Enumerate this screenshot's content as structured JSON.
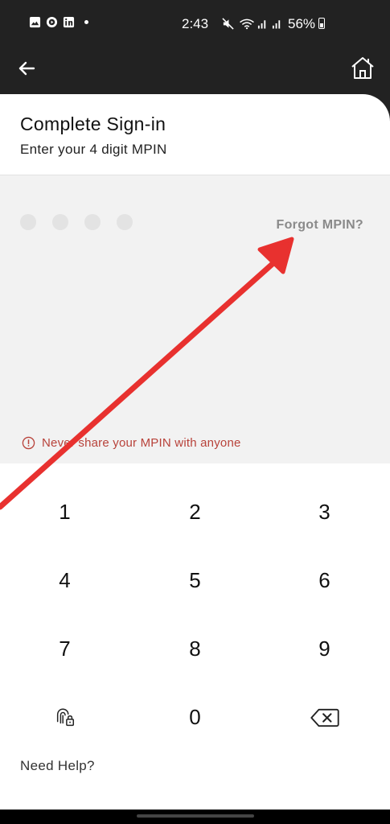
{
  "status_bar": {
    "time": "2:43",
    "battery": "56%",
    "left_icons": [
      "gallery-icon",
      "media-icon",
      "linkedin-icon"
    ],
    "right_icons": [
      "mute-icon",
      "wifi-icon",
      "signal-icon",
      "signal-icon",
      "battery-icon"
    ]
  },
  "app_bar": {
    "back_icon": "back-arrow-icon",
    "home_icon": "home-icon"
  },
  "header": {
    "title": "Complete Sign-in",
    "subtitle": "Enter your 4 digit MPIN"
  },
  "pin": {
    "length": 4,
    "entered": 0,
    "forgot_label": "Forgot MPIN?"
  },
  "warning": {
    "icon": "info-icon",
    "text": "Never share your MPIN with anyone"
  },
  "keypad": {
    "keys": [
      "1",
      "2",
      "3",
      "4",
      "5",
      "6",
      "7",
      "8",
      "9",
      "0"
    ],
    "biometric_icon": "fingerprint-lock-icon",
    "backspace_icon": "backspace-icon"
  },
  "footer": {
    "need_help": "Need Help?"
  },
  "colors": {
    "background": "#222222",
    "card": "#ffffff",
    "pin_area": "#f2f2f2",
    "pin_dot": "#e3e3e3",
    "forgot_text": "#8a8a8a",
    "warning_text": "#b8423a",
    "annotation_arrow": "#e8312f"
  }
}
